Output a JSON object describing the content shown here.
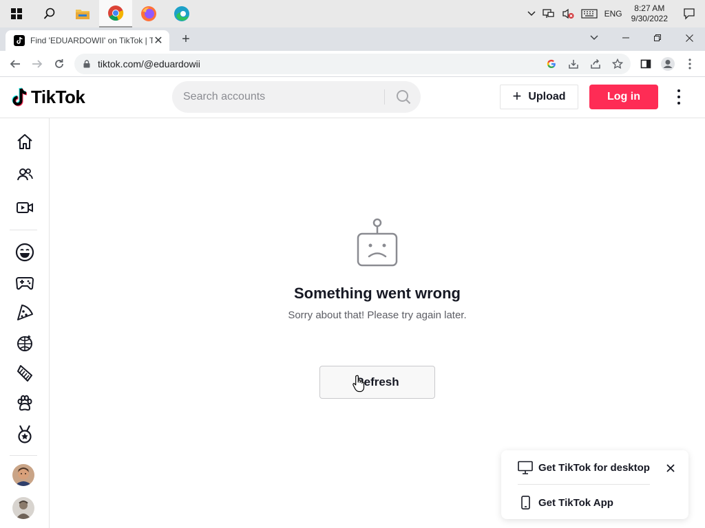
{
  "taskbar": {
    "apps": [
      {
        "name": "start-icon"
      },
      {
        "name": "search-icon"
      },
      {
        "name": "file-explorer-icon"
      },
      {
        "name": "chrome-icon",
        "active": true
      },
      {
        "name": "firefox-icon"
      },
      {
        "name": "edge-icon"
      }
    ],
    "language": "ENG",
    "time": "8:27 AM",
    "date": "9/30/2022"
  },
  "browser": {
    "tab_title": "Find 'EDUARDOWII' on TikTok | T",
    "tab_close": "✕",
    "new_tab": "+",
    "url": "tiktok.com/@eduardowii"
  },
  "header": {
    "logo_text": "TikTok",
    "search_placeholder": "Search accounts",
    "upload_label": "Upload",
    "upload_plus": "+",
    "login_label": "Log in"
  },
  "sidebar": {
    "items": [
      "home-icon",
      "following-icon",
      "live-icon",
      "comedy-icon",
      "gaming-icon",
      "food-icon",
      "dance-icon",
      "beauty-icon",
      "animals-icon",
      "sports-icon"
    ]
  },
  "error": {
    "title": "Something went wrong",
    "subtitle": "Sorry about that! Please try again later.",
    "refresh_label": "Refresh"
  },
  "promo": {
    "desktop_label": "Get TikTok for desktop",
    "app_label": "Get TikTok App"
  },
  "colors": {
    "brand": "#fe2c55",
    "text": "#161823",
    "muted": "#5b5c63"
  }
}
